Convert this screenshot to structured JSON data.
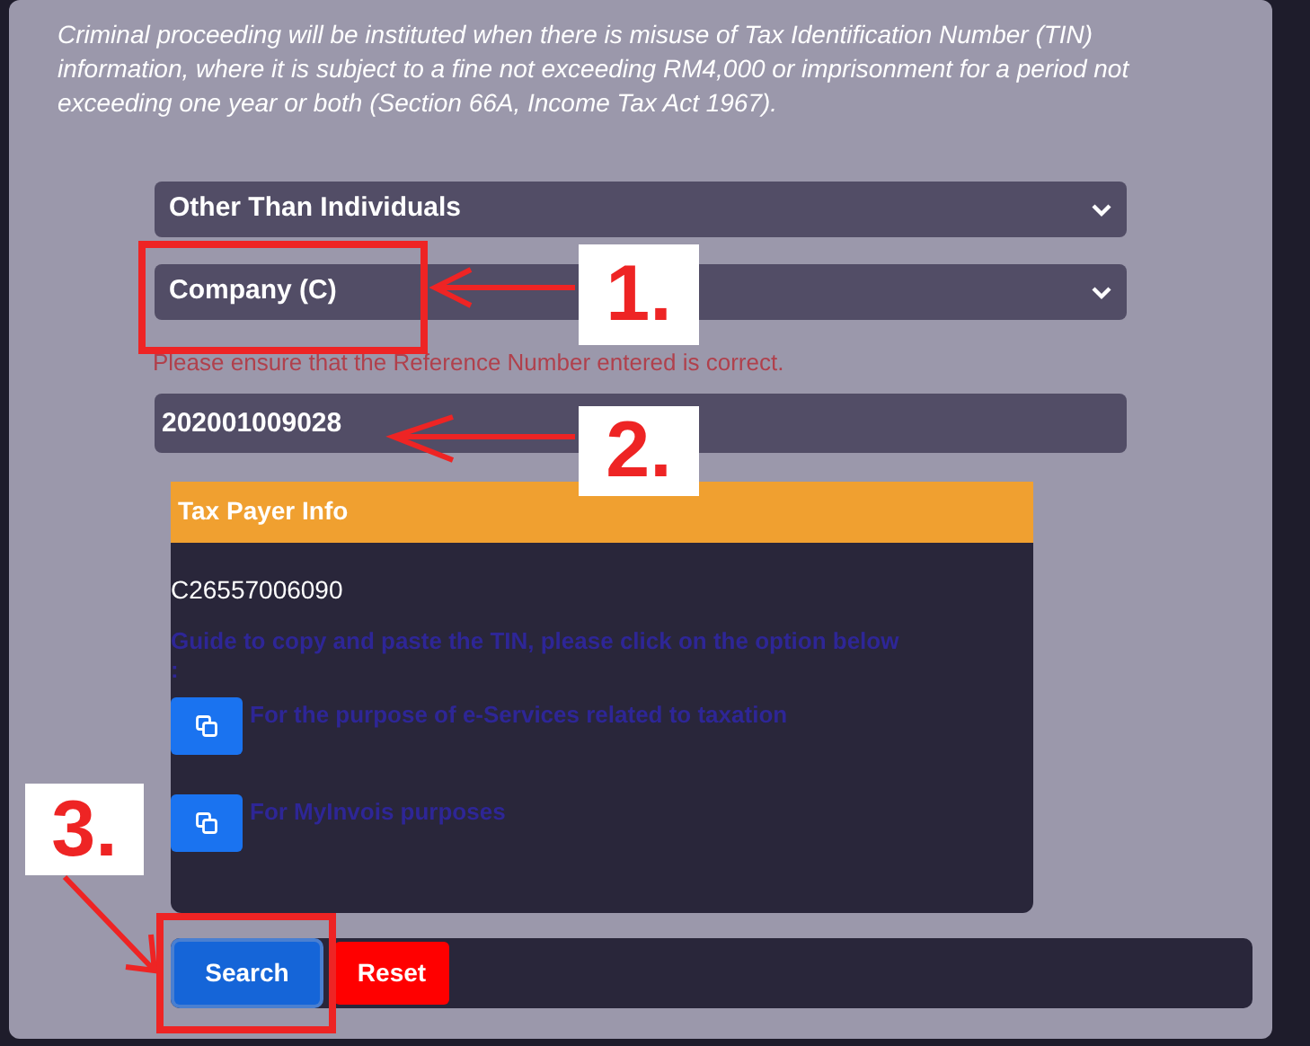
{
  "notice": "Criminal proceeding will be instituted when there is misuse of Tax Identification Number (TIN) information, where it is subject to a fine not exceeding RM4,000 or imprisonment for a period not exceeding one year or both (Section 66A, Income Tax Act 1967).",
  "selects": [
    {
      "value": "Other Than Individuals"
    },
    {
      "value": "Company (C)"
    }
  ],
  "error": "Please ensure that the Reference Number entered is correct.",
  "reference_input": {
    "value": "202001009028"
  },
  "taxpayer_card": {
    "title": "Tax Payer Info",
    "tin": "C26557006090",
    "guide": "Guide to copy and paste the TIN, please click on the option below",
    "guide_colon": ":",
    "options": [
      {
        "label": "For the purpose of e-Services related to taxation"
      },
      {
        "label": "For MyInvois purposes"
      }
    ]
  },
  "buttons": [
    {
      "label": "Search",
      "kind": "primary"
    },
    {
      "label": "Reset",
      "kind": "danger"
    }
  ],
  "annotations": [
    {
      "label": "1."
    },
    {
      "label": "2."
    },
    {
      "label": "3."
    }
  ]
}
